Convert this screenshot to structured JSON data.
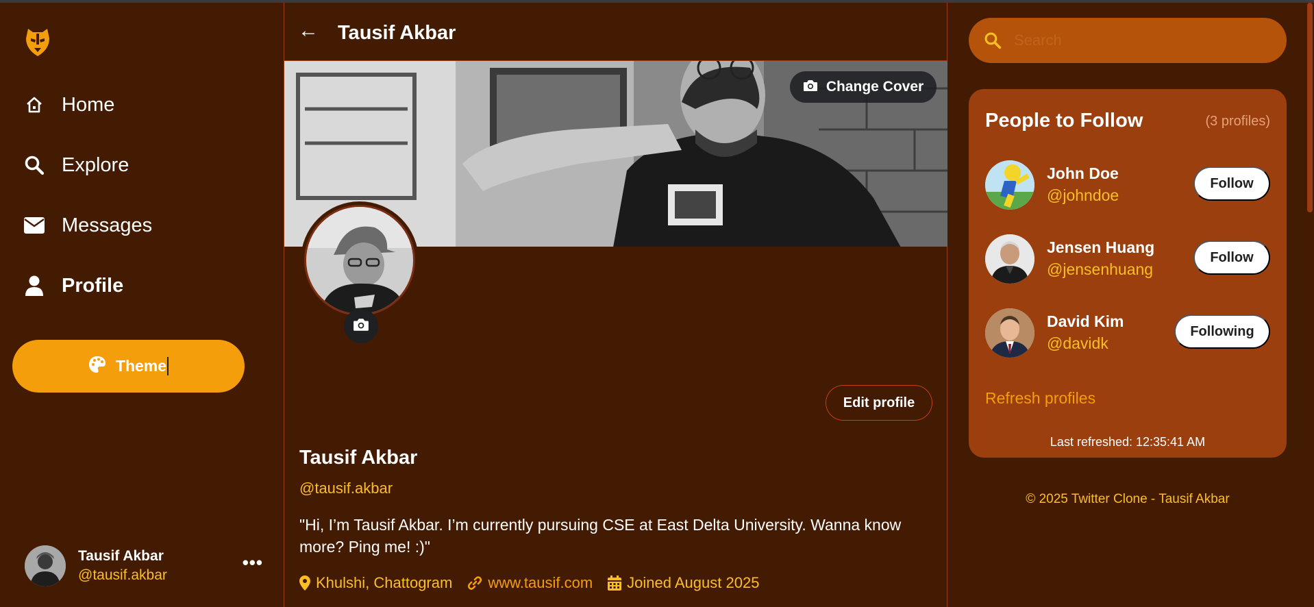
{
  "colors": {
    "background": "#431a02",
    "accent": "#f59e0b",
    "handle": "#fbbf24",
    "search_bg": "#b45309",
    "card_bg": "#9a3f0d"
  },
  "sidebar": {
    "logo": "tiger-mask-icon",
    "nav": [
      {
        "label": "Home",
        "icon": "home-icon"
      },
      {
        "label": "Explore",
        "icon": "search-icon"
      },
      {
        "label": "Messages",
        "icon": "envelope-icon"
      },
      {
        "label": "Profile",
        "icon": "user-icon",
        "active": true
      }
    ],
    "theme_button": {
      "label": "Theme",
      "icon": "palette-icon"
    },
    "current_user": {
      "name": "Tausif Akbar",
      "handle": "@tausif.akbar",
      "more_icon": "ellipsis-icon"
    }
  },
  "main": {
    "header_title": "Tausif Akbar",
    "back_icon": "arrow-left-icon",
    "change_cover_label": "Change Cover",
    "edit_profile_label": "Edit profile",
    "profile": {
      "name": "Tausif Akbar",
      "handle": "@tausif.akbar",
      "bio": "\"Hi, I’m Tausif Akbar. I’m currently pursuing CSE at East Delta University. Wanna know more? Ping me! :)\"",
      "location": "Khulshi, Chattogram",
      "website": "www.tausif.com",
      "joined": "Joined August 2025"
    }
  },
  "right": {
    "search_placeholder": "Search",
    "follow": {
      "title": "People to Follow",
      "count": "(3 profiles)",
      "people": [
        {
          "name": "John Doe",
          "handle": "@johndoe",
          "button": "Follow"
        },
        {
          "name": "Jensen Huang",
          "handle": "@jensenhuang",
          "button": "Follow"
        },
        {
          "name": "David Kim",
          "handle": "@davidk",
          "button": "Following"
        }
      ],
      "refresh_label": "Refresh profiles",
      "last_refreshed": "Last refreshed: 12:35:41 AM"
    },
    "footer": "© 2025 Twitter Clone - Tausif Akbar"
  }
}
